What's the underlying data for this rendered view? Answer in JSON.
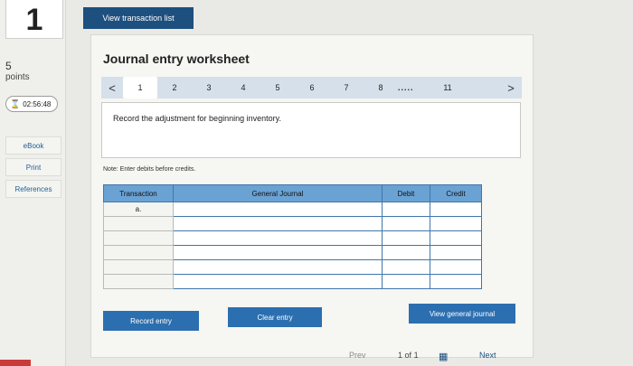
{
  "question": {
    "number": "1",
    "points_value": "5",
    "points_label": "points",
    "timer": "02:56:48"
  },
  "sidebar": {
    "items": [
      {
        "label": "eBook"
      },
      {
        "label": "Print"
      },
      {
        "label": "References"
      }
    ]
  },
  "topbar": {
    "view_transaction_label": "View transaction list"
  },
  "worksheet": {
    "title": "Journal entry worksheet",
    "pages": [
      "1",
      "2",
      "3",
      "4",
      "5",
      "6",
      "7",
      "8"
    ],
    "ellipsis": ".....",
    "last_page": "11",
    "current_page": "1",
    "instruction": "Record the adjustment for beginning inventory.",
    "note": "Note: Enter debits before credits."
  },
  "table": {
    "headers": {
      "transaction": "Transaction",
      "general_journal": "General Journal",
      "debit": "Debit",
      "credit": "Credit"
    },
    "rows": [
      {
        "transaction": "a."
      },
      {
        "transaction": ""
      },
      {
        "transaction": ""
      },
      {
        "transaction": ""
      },
      {
        "transaction": ""
      },
      {
        "transaction": ""
      }
    ]
  },
  "buttons": {
    "record_entry": "Record entry",
    "clear_entry": "Clear entry",
    "view_general_journal": "View general journal"
  },
  "footer": {
    "prev": "Prev",
    "page_current": "1",
    "page_of": "of",
    "page_total": "1",
    "next": "Next"
  },
  "colors": {
    "primary": "#2c6fb0",
    "header_blue": "#6aa2d4",
    "pager_bg": "#d6e0ea"
  },
  "icons": {
    "timer": "hourglass-icon",
    "prev": "chevron-left-icon",
    "next": "chevron-right-icon",
    "grid": "grid-icon"
  }
}
